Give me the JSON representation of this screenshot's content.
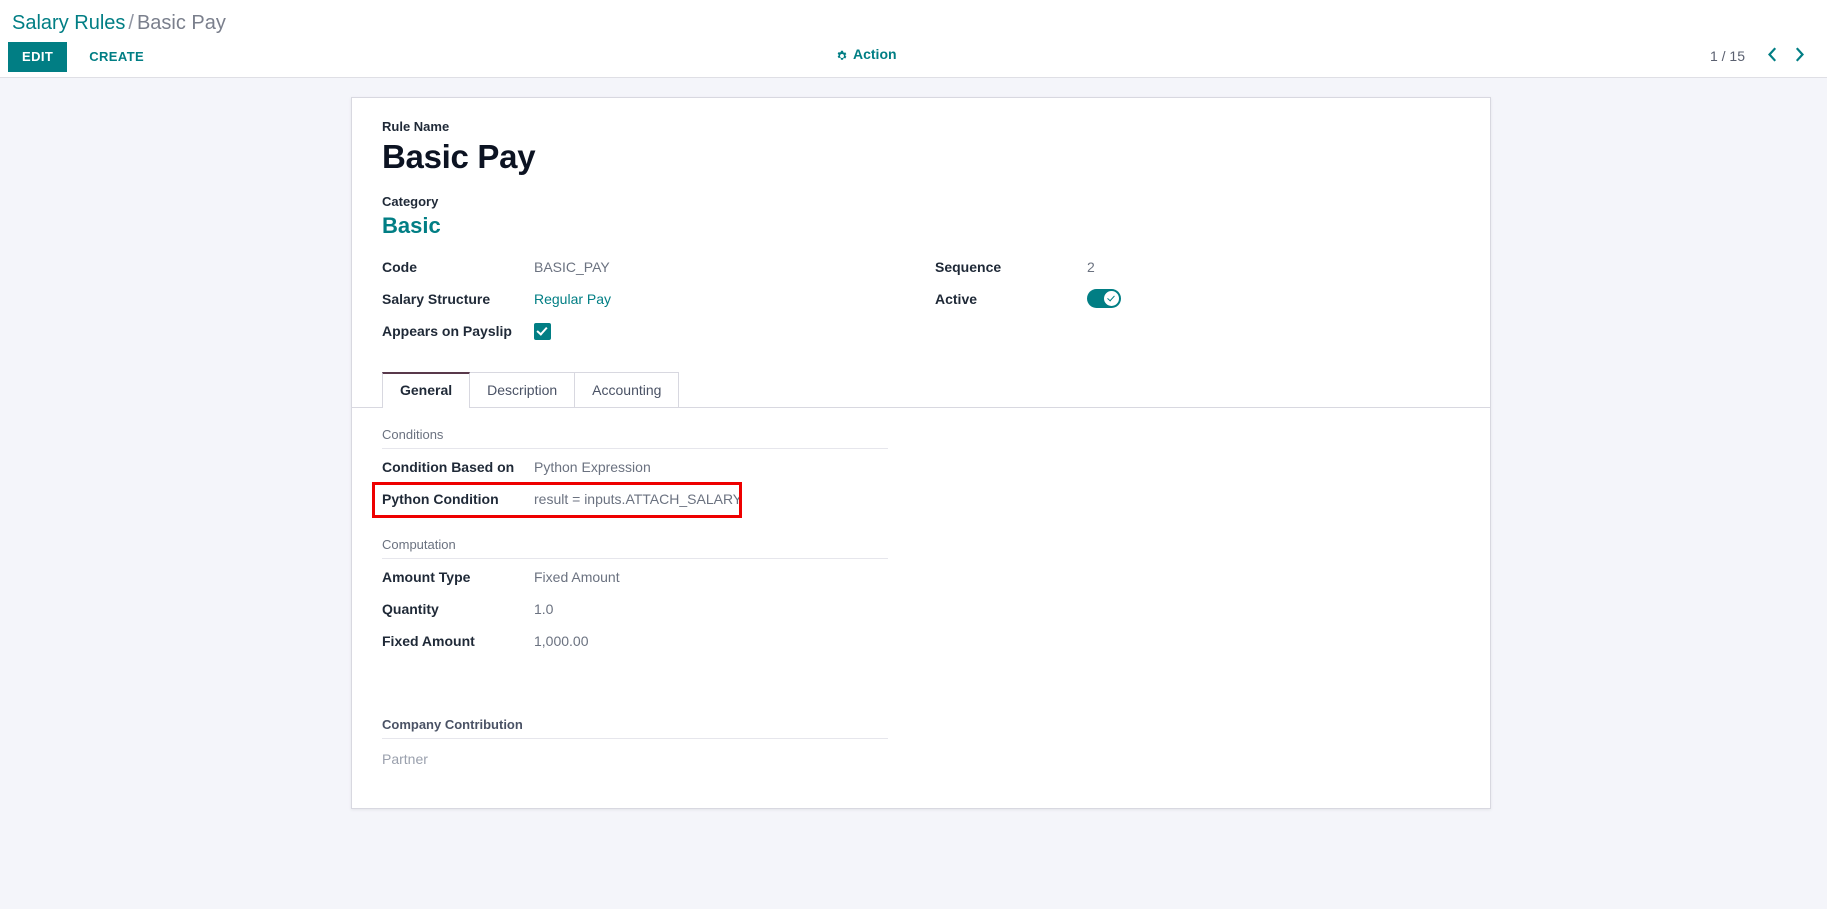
{
  "control_panel": {
    "breadcrumb": {
      "parent": "Salary Rules",
      "separator": "/",
      "current": "Basic Pay"
    },
    "edit_label": "EDIT",
    "create_label": "CREATE",
    "action_label": "Action",
    "action_icon": "gear-icon",
    "pager": {
      "value": "1 / 15",
      "previous_icon": "chevron-left-icon",
      "next_icon": "chevron-right-icon"
    }
  },
  "form": {
    "rule_name_label": "Rule Name",
    "rule_name_value": "Basic Pay",
    "category_label": "Category",
    "category_value": "Basic",
    "left_fields": [
      {
        "label": "Code",
        "value": "BASIC_PAY"
      },
      {
        "label": "Salary Structure",
        "value": "Regular Pay"
      },
      {
        "label": "Appears on Payslip",
        "value": ""
      }
    ],
    "right_fields": [
      {
        "label": "Sequence",
        "value": "2"
      },
      {
        "label": "Active",
        "value": ""
      }
    ],
    "code_label": "Code",
    "code_value": "BASIC_PAY",
    "salary_structure_label": "Salary Structure",
    "salary_structure_value": "Regular Pay",
    "appears_on_payslip_label": "Appears on Payslip",
    "appears_on_payslip_checked": true,
    "sequence_label": "Sequence",
    "sequence_value": "2",
    "active_label": "Active",
    "active_checked": true
  },
  "notebook": {
    "tabs": [
      {
        "label": "General",
        "active": true
      },
      {
        "label": "Description",
        "active": false
      },
      {
        "label": "Accounting",
        "active": false
      }
    ],
    "general": {
      "conditions": {
        "title": "Conditions",
        "condition_based_on_label": "Condition Based on",
        "condition_based_on_value": "Python Expression",
        "python_condition_label": "Python Condition",
        "python_condition_value": "result = inputs.ATTACH_SALARY"
      },
      "computation": {
        "title": "Computation",
        "amount_type_label": "Amount Type",
        "amount_type_value": "Fixed Amount",
        "quantity_label": "Quantity",
        "quantity_value": "1.0",
        "fixed_amount_label": "Fixed Amount",
        "fixed_amount_value": "1,000.00"
      },
      "company_contribution": {
        "title": "Company Contribution",
        "partner_placeholder": "Partner"
      }
    }
  },
  "colors": {
    "accent": "#017E84",
    "page_background": "#F4F5FA",
    "annotation_red": "#EE0000",
    "active_tab_border": "#59394b"
  }
}
